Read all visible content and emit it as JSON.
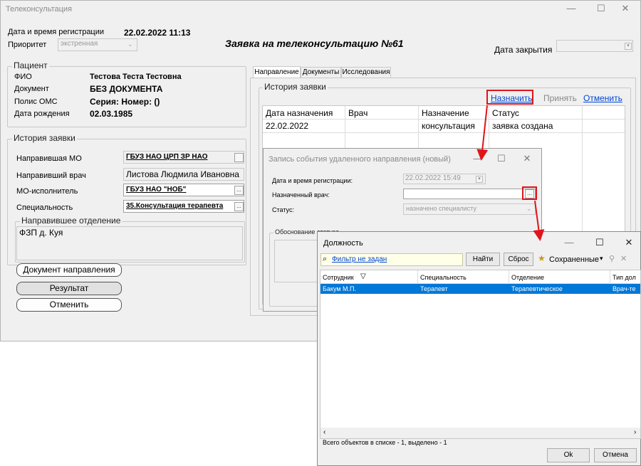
{
  "main_window": {
    "title": "Телеконсультация",
    "min_glyph": "—",
    "max_glyph": "☐",
    "close_glyph": "✕",
    "reg_datetime_label": "Дата и время регистрации",
    "reg_datetime_value": "22.02.2022 11:13",
    "priority_label": "Приоритет",
    "priority_value": "экстренная",
    "request_title": "Заявка на телеконсультацию №",
    "request_number": "61",
    "close_date_label": "Дата закрытия",
    "close_date_value": ""
  },
  "patient": {
    "group_title": "Пациент",
    "fio_label": "ФИО",
    "fio_value": "Тестова Теста Тестовна",
    "doc_label": "Документ",
    "doc_value": "БЕЗ ДОКУМЕНТА",
    "polis_label": "Полис ОМС",
    "polis_value": "Серия:  Номер: ()",
    "dob_label": "Дата рождения",
    "dob_value": "02.03.1985"
  },
  "history_left": {
    "group_title": "История заявки",
    "mo_label": "Направившая МО",
    "mo_value": "ГБУЗ НАО ЦРП ЗР НАО",
    "doctor_label": "Направивший врач",
    "doctor_value": "Листова Людмила Ивановна",
    "executor_label": "МО-исполнитель",
    "executor_value": "ГБУЗ НАО \"НОБ\"",
    "spec_label": "Специальность",
    "spec_value": "35.Консультация терапевта",
    "dept_group_title": "Направившее отделение",
    "dept_value": "ФЗП д. Куя"
  },
  "left_buttons": {
    "doc_button": "Документ направления",
    "result_button": "Результат",
    "cancel_button": "Отменить"
  },
  "tabs": [
    "Направление",
    "Документы",
    "Исследования"
  ],
  "history_right": {
    "group_title": "История заявки",
    "assign_link": "Назначить",
    "accept_link": "Принять",
    "cancel_link": "Отменить",
    "columns": [
      "Дата назначения",
      "Врач",
      "Назначение",
      "Статус"
    ],
    "rows": [
      {
        "date": "22.02.2022",
        "doctor": "",
        "purpose": "консультация",
        "status": "заявка создана"
      }
    ]
  },
  "event_dialog": {
    "title": "Запись события удаленного направления (новый)",
    "reg_label": "Дата и время регистрации:",
    "reg_value": "22.02.2022 15:49",
    "doctor_label": "Назначенный врач:",
    "doctor_value": "",
    "status_label": "Статус:",
    "status_value": "назначено специалисту",
    "reason_label": "Обоснование статуса"
  },
  "position_dialog": {
    "title": "Должность",
    "filter_text": "Фильтр не задан",
    "find_button": "Найти",
    "reset_button": "Сброс",
    "saved_button": "Сохраненные",
    "columns": [
      "Сотрудник",
      "Специальность",
      "Отделение",
      "Тип дол"
    ],
    "rows": [
      {
        "employee": "Бакум М.П.",
        "specialty": "Терапевт",
        "department": "Терапевтическое",
        "type": "Врач-те"
      }
    ],
    "status_text": "Всего объектов в списке - 1, выделено - 1",
    "ok_button": "Ok",
    "cancel_button": "Отмена"
  },
  "colors": {
    "accent_red": "#e0141b",
    "link_blue": "#0046d5",
    "selection_blue": "#0078d7"
  }
}
